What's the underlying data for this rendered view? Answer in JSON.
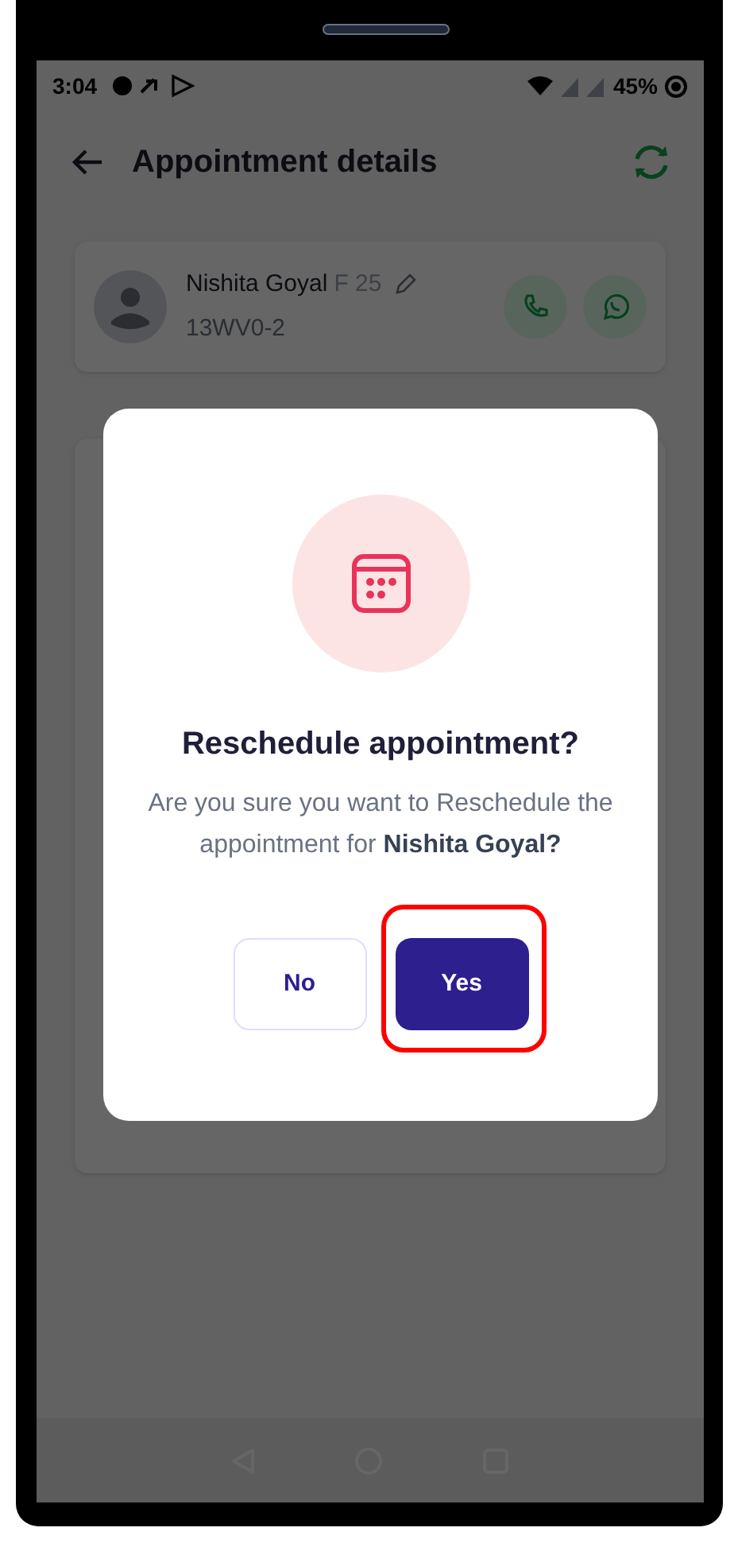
{
  "status_bar": {
    "time": "3:04",
    "battery": "45%"
  },
  "header": {
    "title": "Appointment details"
  },
  "patient": {
    "name": "Nishita Goyal",
    "gender_age": "F 25",
    "id": "13WV0-2"
  },
  "dialog": {
    "title": "Reschedule appointment?",
    "message": "Are you sure you want to Reschedule the appointment for **Nishita Goyal?**",
    "buttons": [
      {
        "label": "No",
        "kind": "secondary",
        "highlighted": false
      },
      {
        "label": "Yes",
        "kind": "primary",
        "highlighted": true
      }
    ]
  }
}
